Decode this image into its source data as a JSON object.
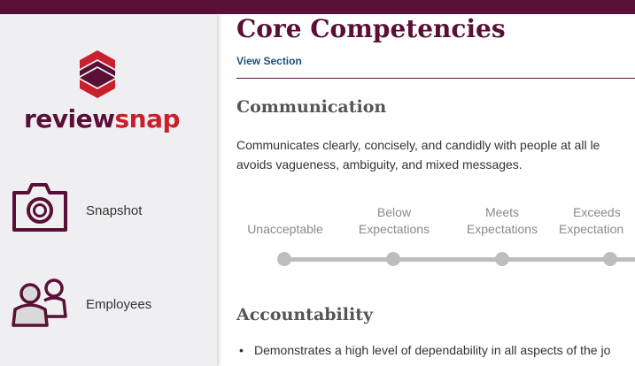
{
  "brand": {
    "name_part1": "review",
    "name_part2": "snap",
    "colors": {
      "primary": "#5a1036",
      "accent": "#c8202c",
      "topbar": "#5a1036"
    }
  },
  "sidebar": {
    "items": [
      {
        "label": "Snapshot",
        "icon": "camera-icon"
      },
      {
        "label": "Employees",
        "icon": "people-icon"
      }
    ]
  },
  "main": {
    "section_title": "Core Competencies",
    "view_section_link": "View Section",
    "competencies": [
      {
        "title": "Communication",
        "description_line1": "Communicates clearly, concisely, and candidly with people at all le",
        "description_line2": "avoids vagueness, ambiguity, and mixed messages.",
        "rating_scale": [
          {
            "line1": "",
            "line2": "Unacceptable"
          },
          {
            "line1": "Below",
            "line2": "Expectations"
          },
          {
            "line1": "Meets",
            "line2": "Expectations"
          },
          {
            "line1": "Exceeds",
            "line2": "Expectation"
          }
        ]
      },
      {
        "title": "Accountability",
        "bullets": [
          "Demonstrates a high level of dependability in all aspects of the jo"
        ]
      }
    ]
  }
}
